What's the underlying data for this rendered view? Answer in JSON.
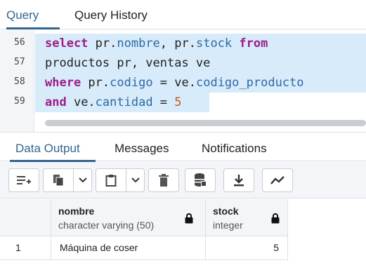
{
  "top_tabs": [
    {
      "label": "Query",
      "active": true
    },
    {
      "label": "Query History",
      "active": false
    }
  ],
  "editor": {
    "line_numbers": [
      "56",
      "57",
      "58",
      "59"
    ],
    "lines": [
      [
        {
          "t": "select",
          "c": "kw"
        },
        {
          "t": " pr.",
          "c": ""
        },
        {
          "t": "nombre",
          "c": "prop"
        },
        {
          "t": ", pr.",
          "c": ""
        },
        {
          "t": "stock",
          "c": "prop"
        },
        {
          "t": " ",
          "c": ""
        },
        {
          "t": "from",
          "c": "kw"
        }
      ],
      [
        {
          "t": "productos pr, ventas ve",
          "c": ""
        }
      ],
      [
        {
          "t": "where",
          "c": "kw"
        },
        {
          "t": " pr.",
          "c": ""
        },
        {
          "t": "codigo",
          "c": "prop"
        },
        {
          "t": " = ve.",
          "c": ""
        },
        {
          "t": "codigo_producto",
          "c": "prop"
        }
      ],
      [
        {
          "t": "and",
          "c": "kw"
        },
        {
          "t": " ve.",
          "c": ""
        },
        {
          "t": "cantidad",
          "c": "prop"
        },
        {
          "t": " = ",
          "c": ""
        },
        {
          "t": "5",
          "c": "num"
        }
      ]
    ]
  },
  "bottom_tabs": [
    {
      "label": "Data Output",
      "active": true
    },
    {
      "label": "Messages",
      "active": false
    },
    {
      "label": "Notifications",
      "active": false
    }
  ],
  "toolbar": {
    "icons": [
      "add-row-icon",
      "copy-icon",
      "chevron-down-icon",
      "paste-icon",
      "chevron-down-icon",
      "delete-icon",
      "save-data-icon",
      "download-icon",
      "graph-icon"
    ]
  },
  "grid": {
    "columns": [
      {
        "name": "nombre",
        "type": "character varying (50)"
      },
      {
        "name": "stock",
        "type": "integer"
      }
    ],
    "rows": [
      {
        "index": "1",
        "cells": [
          "Máquina de coser",
          "5"
        ]
      }
    ]
  },
  "colors": {
    "accent": "#326690",
    "selection": "#d7ebfa",
    "keyword": "#9d1d88",
    "property": "#2d6aa6",
    "number": "#c35b1c"
  }
}
